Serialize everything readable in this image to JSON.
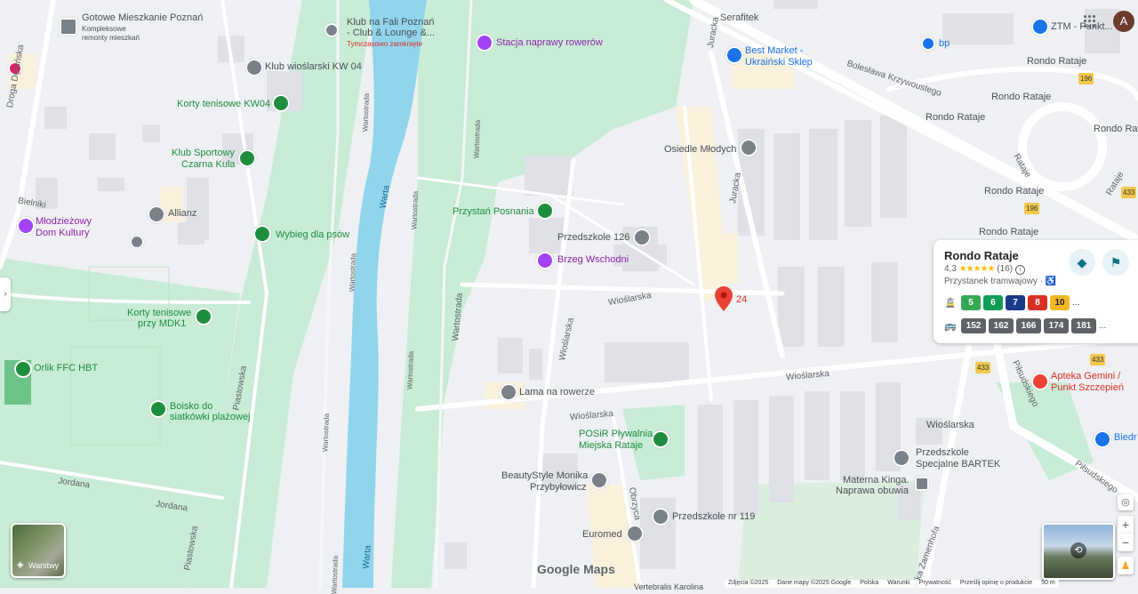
{
  "map": {
    "logo": "Google Maps",
    "labels": {
      "gotowe_title": "Gotowe Mieszkanie Poznań",
      "gotowe_sub1": "Kompleksowe",
      "gotowe_sub2": "remonty mieszkań",
      "klub_fali_1": "Klub na Fali Poznań",
      "klub_fali_2": "- Club & Lounge &...",
      "klub_fali_3": "Tymczasowo zamknięte",
      "stacja": "Stacja naprawy rowerów",
      "serafitek": "Serafitek",
      "best_market_1": "Best Market -",
      "best_market_2": "Ukraiński Sklep",
      "ztm": "ZTM - Punkt...",
      "bp": "bp",
      "klub_kw04": "Klub wioślarski KW 04",
      "korty_kw04": "Korty tenisowe KW04",
      "osiedle": "Osiedle Młodych",
      "klub_sportowy_1": "Klub Sportowy",
      "klub_sportowy_2": "Czarna Kula",
      "allianz": "Allianz",
      "mlodziezowy_1": "Młodzieżowy",
      "mlodziezowy_2": "Dom Kultury",
      "bielniki": "Bielniki",
      "wybieg": "Wybieg dla psów",
      "przystan": "Przystań Posnania",
      "przedszkole126": "Przedszkole 126",
      "brzeg": "Brzeg Wschodni",
      "korty_mdk_1": "Korty tenisowe",
      "korty_mdk_2": "przy MDK1",
      "orlik": "Orlik FFC HBT",
      "boisko_1": "Boisko do",
      "boisko_2": "siatkówki plażowej",
      "lama": "Lama na rowerze",
      "posir_1": "POSiR Pływalnia",
      "posir_2": "Miejska Rataje",
      "beauty_1": "BeautyStyle Monika",
      "beauty_2": "Przybyłowicz",
      "przedszkole119": "Przedszkole nr 119",
      "euromed": "Euromed",
      "apteka_1": "Apteka Gemini /",
      "apteka_2": "Punkt Szczepień",
      "bartek_1": "Przedszkole",
      "bartek_2": "Specjalne BARTEK",
      "materna_1": "Materna Kinga.",
      "materna_2": "Naprawa obuwia",
      "biedronka": "Biedr",
      "wioslarska_shop": "Wioślarska",
      "rondo1": "Rondo Rataje",
      "rondo2": "Rondo Rataje",
      "rondo3": "Rondo Rataje",
      "rondo4": "Rondo Rataje",
      "rondo5": "Rondo Rataje",
      "rondo6": "Rondo Rataje",
      "pin_num": "24",
      "vertebralis": "Vertebralis Karolina"
    },
    "roads": {
      "droga_debinska": "Droga Dębińska",
      "warta1": "Warta",
      "warta2": "Warta",
      "wartostrada1": "Wartostrada",
      "wartostrada2": "Wartostrada",
      "wartostrada3": "Wartostrada",
      "wartostrada4": "Wartostrada",
      "wartostrada5": "Wartostrada",
      "wartostrada6": "Wartostrada",
      "wartostrada7": "Wartostrada",
      "wartostrada8": "Wartostrada",
      "juracka1": "Juracka",
      "juracka2": "Juracka",
      "boleslawa": "Bolesława Krzywoustego",
      "wioslarska1": "Wioślarska",
      "wioslarska2": "Wioślarska",
      "wioslarska3": "Wioślarska",
      "wioslarska4": "Wioślarska",
      "obrzyca": "Obrzyca",
      "jordana1": "Jordana",
      "jordana2": "Jordana",
      "piastowska1": "Piastowska",
      "piastowska2": "Piastowska",
      "pilsudskiego1": "Piłsudskiego",
      "pilsudskiego2": "Piłsudskiego",
      "zamenhofa": "wika Zamenhofa",
      "rataje1": "Rataje",
      "rataje2": "Rataje",
      "shield196a": "196",
      "shield196b": "196",
      "shield433a": "433",
      "shield433b": "433",
      "shield433c": "433"
    }
  },
  "card": {
    "title": "Rondo Rataje",
    "rating": "4,3",
    "stars": "★★★★★",
    "review_count": "(16)",
    "subtitle": "Przystanek tramwajowy ·",
    "tram_lines": [
      {
        "label": "5",
        "color": "#34a853"
      },
      {
        "label": "6",
        "color": "#0f9d58"
      },
      {
        "label": "7",
        "color": "#1a3a8a"
      },
      {
        "label": "8",
        "color": "#d93025"
      },
      {
        "label": "10",
        "color": "#f2b824"
      }
    ],
    "bus_lines": [
      "152",
      "162",
      "166",
      "174",
      "181"
    ],
    "more": "..."
  },
  "controls": {
    "layers_label": "Warstwy",
    "avatar_letter": "A",
    "zoom_in": "+",
    "zoom_out": "−"
  },
  "footer": {
    "items": [
      "Zdjęcia ©2025",
      "Dane mapy ©2025 Google",
      "Polska",
      "Warunki",
      "Prywatność",
      "Prześlij opinię o produkcie",
      "50 m"
    ]
  },
  "colors": {
    "park": "#c8ecd6",
    "water": "#90d5ec",
    "road": "#ffffff",
    "building": "#e1e3e8",
    "residential": "#f9f1dc",
    "brand_red": "#ea4335"
  }
}
